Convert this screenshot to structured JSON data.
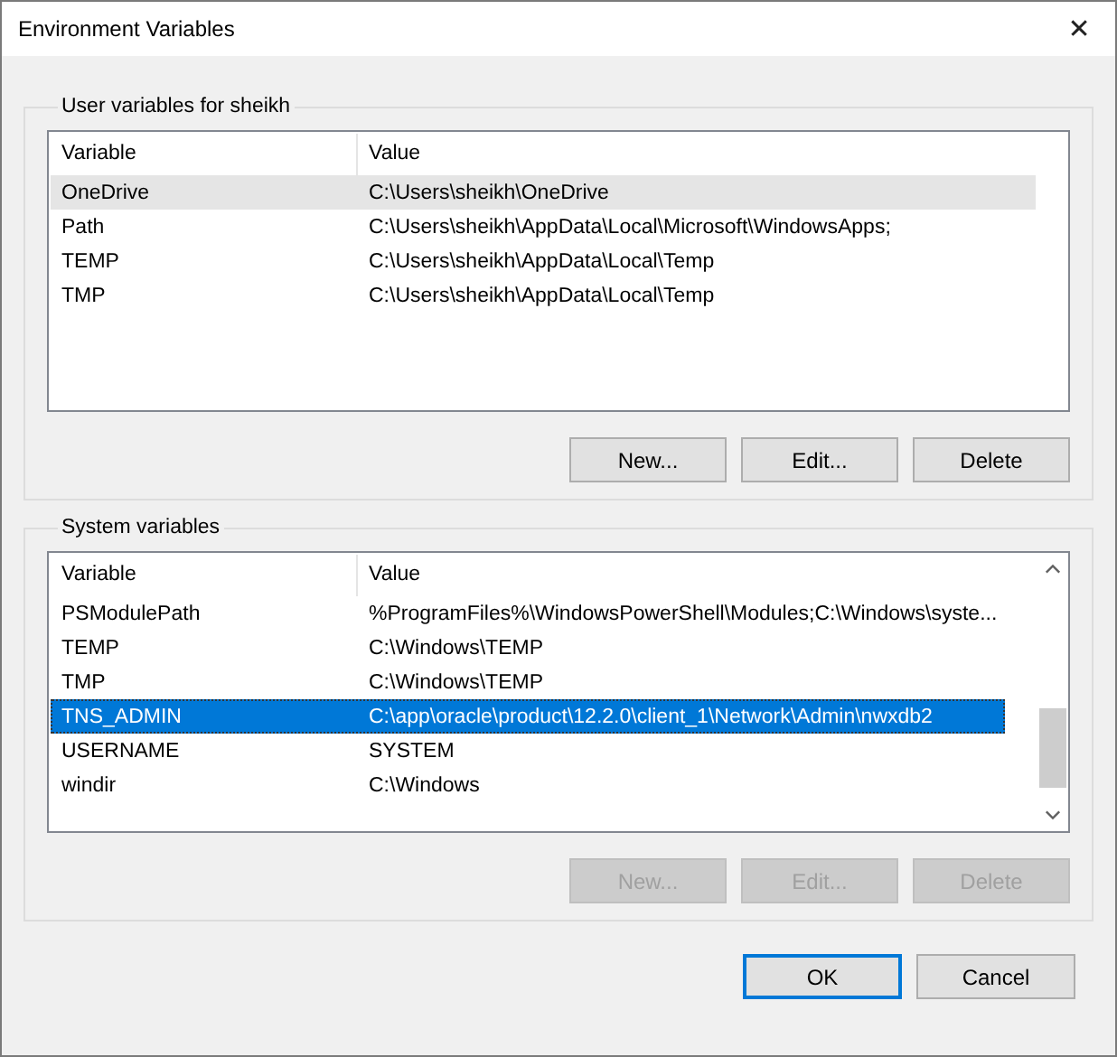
{
  "window": {
    "title": "Environment Variables",
    "close": "✕"
  },
  "groups": [
    {
      "label": "User variables for sheikh",
      "columns": [
        "Variable",
        "Value"
      ],
      "scrollbar": false,
      "rows": [
        {
          "variable": "OneDrive",
          "value": "C:\\Users\\sheikh\\OneDrive",
          "selected": false,
          "hovered": true
        },
        {
          "variable": "Path",
          "value": "C:\\Users\\sheikh\\AppData\\Local\\Microsoft\\WindowsApps;",
          "selected": false,
          "hovered": false
        },
        {
          "variable": "TEMP",
          "value": "C:\\Users\\sheikh\\AppData\\Local\\Temp",
          "selected": false,
          "hovered": false
        },
        {
          "variable": "TMP",
          "value": "C:\\Users\\sheikh\\AppData\\Local\\Temp",
          "selected": false,
          "hovered": false
        }
      ],
      "buttons": [
        {
          "label": "New...",
          "disabled": false
        },
        {
          "label": "Edit...",
          "disabled": false
        },
        {
          "label": "Delete",
          "disabled": false
        }
      ]
    },
    {
      "label": "System variables",
      "columns": [
        "Variable",
        "Value"
      ],
      "scrollbar": true,
      "rows": [
        {
          "variable": "PSModulePath",
          "value": "%ProgramFiles%\\WindowsPowerShell\\Modules;C:\\Windows\\syste...",
          "selected": false,
          "hovered": false
        },
        {
          "variable": "TEMP",
          "value": "C:\\Windows\\TEMP",
          "selected": false,
          "hovered": false
        },
        {
          "variable": "TMP",
          "value": "C:\\Windows\\TEMP",
          "selected": false,
          "hovered": false
        },
        {
          "variable": "TNS_ADMIN",
          "value": "C:\\app\\oracle\\product\\12.2.0\\client_1\\Network\\Admin\\nwxdb2",
          "selected": true,
          "hovered": false
        },
        {
          "variable": "USERNAME",
          "value": "SYSTEM",
          "selected": false,
          "hovered": false
        },
        {
          "variable": "windir",
          "value": "C:\\Windows",
          "selected": false,
          "hovered": false
        }
      ],
      "buttons": [
        {
          "label": "New...",
          "disabled": true
        },
        {
          "label": "Edit...",
          "disabled": true
        },
        {
          "label": "Delete",
          "disabled": true
        }
      ]
    }
  ],
  "footer_buttons": [
    {
      "label": "OK",
      "default": true
    },
    {
      "label": "Cancel",
      "default": false
    }
  ]
}
